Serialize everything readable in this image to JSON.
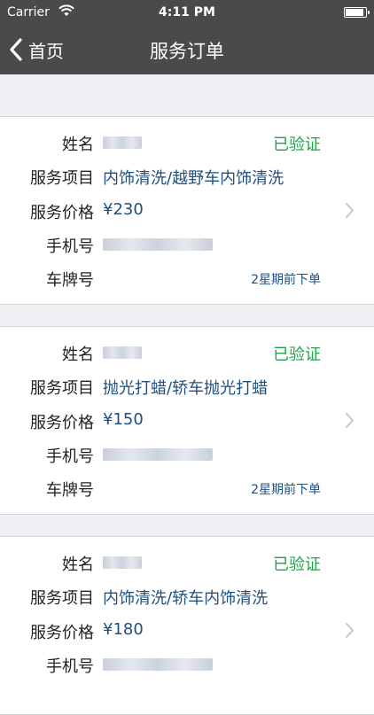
{
  "status_bar": {
    "carrier": "Carrier",
    "time": "4:11 PM"
  },
  "nav": {
    "back_label": "首页",
    "title": "服务订单"
  },
  "labels": {
    "name": "姓名",
    "service": "服务项目",
    "price": "服务价格",
    "phone": "手机号",
    "plate": "车牌号"
  },
  "orders": [
    {
      "service": "内饰清洗/越野车内饰清洗",
      "price": "¥230",
      "status": "已验证",
      "ordered": "2星期前下单"
    },
    {
      "service": "抛光打蜡/轿车抛光打蜡",
      "price": "¥150",
      "status": "已验证",
      "ordered": "2星期前下单"
    },
    {
      "service": "内饰清洗/轿车内饰清洗",
      "price": "¥180",
      "status": "已验证",
      "ordered": ""
    }
  ],
  "colors": {
    "nav_bg": "#4a4a4a",
    "verified": "#25a14a",
    "value_text": "#1e4f7f",
    "background": "#efeff4"
  },
  "icons": {
    "back": "chevron-left-icon",
    "disclosure": "chevron-right-icon",
    "wifi": "wifi-icon",
    "battery": "battery-icon"
  }
}
